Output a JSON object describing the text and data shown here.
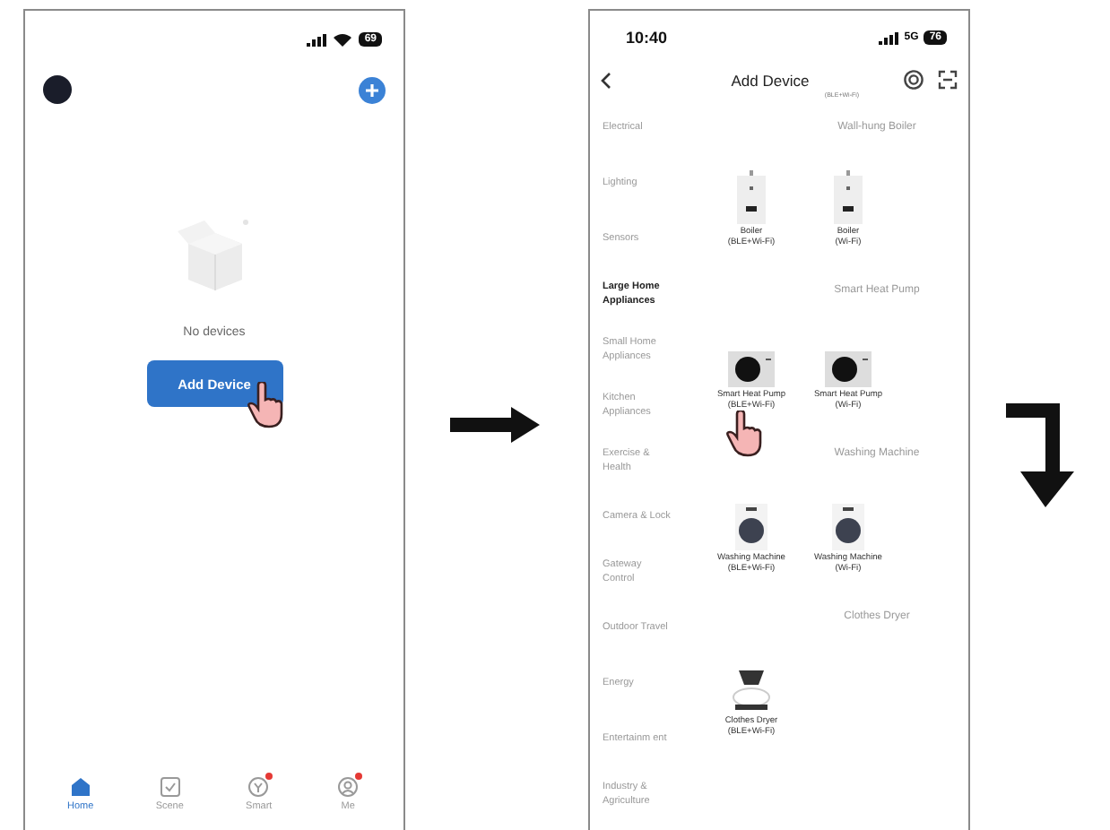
{
  "home_screen": {
    "status_bar": {
      "battery": "69"
    },
    "empty_state": {
      "message": "No devices"
    },
    "add_button": {
      "label": "Add Device",
      "tapped": true
    },
    "tab_bar": [
      {
        "label": "Home",
        "kind": "home",
        "selected": true,
        "badge": false
      },
      {
        "label": "Scene",
        "kind": "scene",
        "selected": false,
        "badge": false
      },
      {
        "label": "Smart",
        "kind": "smart",
        "selected": false,
        "badge": true
      },
      {
        "label": "Me",
        "kind": "me",
        "selected": false,
        "badge": true
      }
    ]
  },
  "add_device_screen": {
    "status_bar": {
      "time": "10:40",
      "network": "5G",
      "battery": "76"
    },
    "title": "Add Device",
    "cut_text": "(BLE+Wi-Fi)",
    "categories": [
      {
        "label": "Electrical",
        "selected": false
      },
      {
        "label": "Lighting",
        "selected": false
      },
      {
        "label": "Sensors",
        "selected": false
      },
      {
        "label": "Large Home Appliances",
        "selected": true
      },
      {
        "label": "Small Home Appliances",
        "selected": false
      },
      {
        "label": "Kitchen Appliances",
        "selected": false
      },
      {
        "label": "Exercise & Health",
        "selected": false
      },
      {
        "label": "Camera & Lock",
        "selected": false
      },
      {
        "label": "Gateway Control",
        "selected": false
      },
      {
        "label": "Outdoor Travel",
        "selected": false
      },
      {
        "label": "Energy",
        "selected": false
      },
      {
        "label": "Entertainm ent",
        "selected": false
      },
      {
        "label": "Industry & Agriculture",
        "selected": false
      }
    ],
    "groups": [
      {
        "title": "Wall-hung Boiler",
        "kind": "boiler",
        "devices": [
          {
            "name": "Boiler",
            "protocol": "(BLE+Wi-Fi)",
            "tapped": false
          },
          {
            "name": "Boiler",
            "protocol": "(Wi-Fi)",
            "tapped": false
          }
        ]
      },
      {
        "title": "Smart Heat Pump",
        "kind": "heat-pump",
        "devices": [
          {
            "name": "Smart Heat Pump",
            "protocol": "(BLE+Wi-Fi)",
            "tapped": true
          },
          {
            "name": "Smart Heat Pump",
            "protocol": "(Wi-Fi)",
            "tapped": false
          }
        ]
      },
      {
        "title": "Washing Machine",
        "kind": "washer",
        "devices": [
          {
            "name": "Washing Machine",
            "protocol": "(BLE+Wi-Fi)",
            "tapped": false
          },
          {
            "name": "Washing Machine",
            "protocol": "(Wi-Fi)",
            "tapped": false
          }
        ]
      },
      {
        "title": "Clothes Dryer",
        "kind": "dryer",
        "devices": [
          {
            "name": "Clothes Dryer",
            "protocol": "(BLE+Wi-Fi)",
            "tapped": false
          }
        ]
      }
    ]
  }
}
